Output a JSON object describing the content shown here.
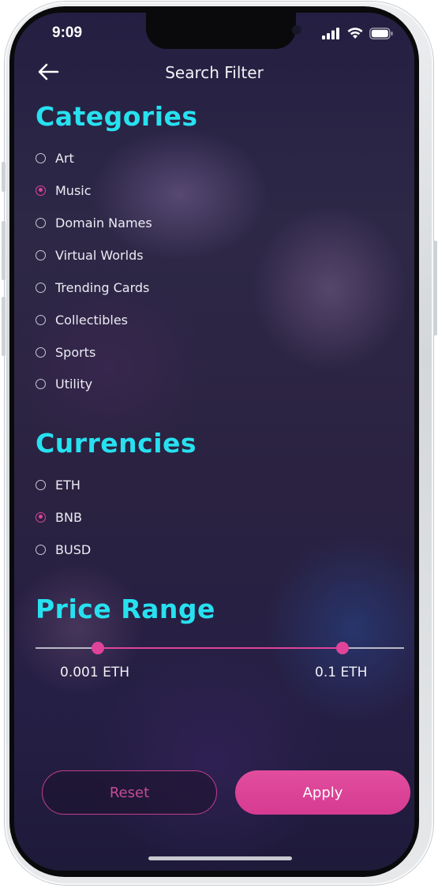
{
  "status_bar": {
    "time": "9:09"
  },
  "header": {
    "title": "Search Filter"
  },
  "categories": {
    "title": "Categories",
    "options": [
      {
        "label": "Art",
        "checked": false
      },
      {
        "label": "Music",
        "checked": true
      },
      {
        "label": "Domain Names",
        "checked": false
      },
      {
        "label": "Virtual Worlds",
        "checked": false
      },
      {
        "label": "Trending Cards",
        "checked": false
      },
      {
        "label": "Collectibles",
        "checked": false
      },
      {
        "label": "Sports",
        "checked": false
      },
      {
        "label": "Utility",
        "checked": false
      }
    ]
  },
  "currencies": {
    "title": "Currencies",
    "options": [
      {
        "label": "ETH",
        "checked": false
      },
      {
        "label": "BNB",
        "checked": true
      },
      {
        "label": "BUSD",
        "checked": false
      }
    ]
  },
  "price_range": {
    "title": "Price Range",
    "min_label": "0.001 ETH",
    "max_label": "0.1 ETH",
    "min_fraction": 0.17,
    "max_fraction": 0.833
  },
  "buttons": {
    "reset": "Reset",
    "apply": "Apply"
  },
  "colors": {
    "accent": "#27e1f0",
    "primary": "#e0449a",
    "background": "#2a2240"
  }
}
